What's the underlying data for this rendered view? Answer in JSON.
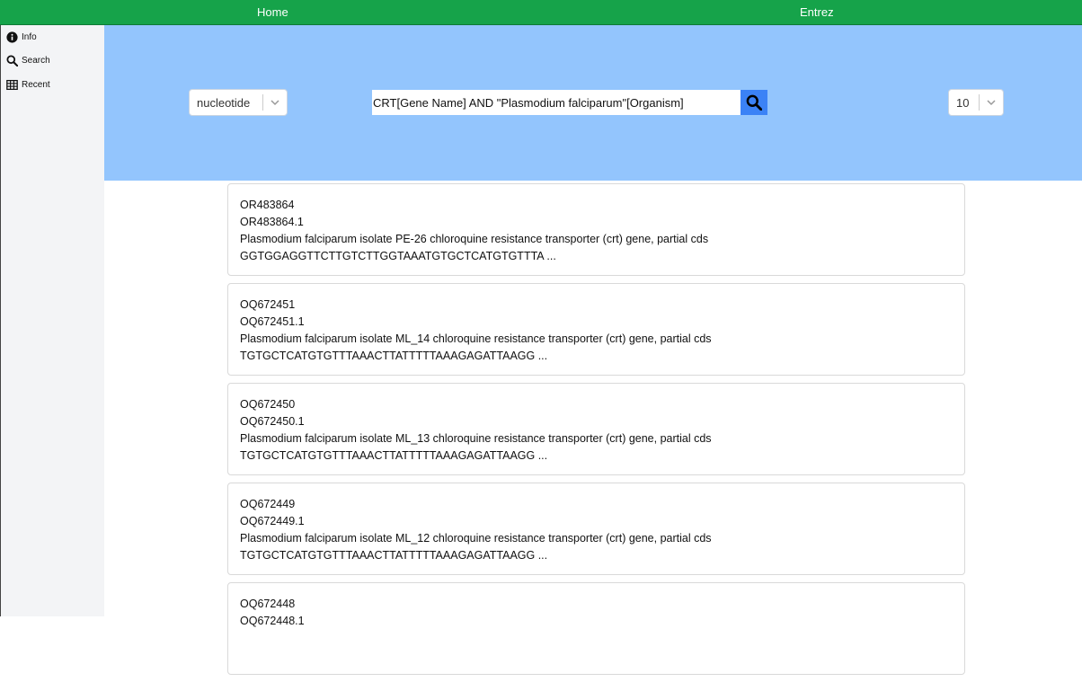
{
  "nav": {
    "home": "Home",
    "entrez": "Entrez"
  },
  "sidebar": {
    "items": [
      {
        "label": "Info",
        "icon": "info-icon"
      },
      {
        "label": "Search",
        "icon": "search-icon"
      },
      {
        "label": "Recent",
        "icon": "table-icon"
      }
    ]
  },
  "search": {
    "database": "nucleotide",
    "query": "CRT[Gene Name] AND \"Plasmodium falciparum\"[Organism]",
    "count": "10"
  },
  "colors": {
    "topbar": "#16a34a",
    "search_panel": "#93c5fd",
    "search_button": "#3b82f6",
    "sidebar": "#f3f4f6"
  },
  "results": [
    {
      "id": "OR483864",
      "accession": "OR483864.1",
      "title": "Plasmodium falciparum isolate PE-26 chloroquine resistance transporter (crt) gene, partial cds",
      "sequence": "GGTGGAGGTTCTTGTCTTGGTAAATGTGCTCATGTGTTTA ..."
    },
    {
      "id": "OQ672451",
      "accession": "OQ672451.1",
      "title": "Plasmodium falciparum isolate ML_14 chloroquine resistance transporter (crt) gene, partial cds",
      "sequence": "TGTGCTCATGTGTTTAAACTTATTTTTAAAGAGATTAAGG ..."
    },
    {
      "id": "OQ672450",
      "accession": "OQ672450.1",
      "title": "Plasmodium falciparum isolate ML_13 chloroquine resistance transporter (crt) gene, partial cds",
      "sequence": "TGTGCTCATGTGTTTAAACTTATTTTTAAAGAGATTAAGG ..."
    },
    {
      "id": "OQ672449",
      "accession": "OQ672449.1",
      "title": "Plasmodium falciparum isolate ML_12 chloroquine resistance transporter (crt) gene, partial cds",
      "sequence": "TGTGCTCATGTGTTTAAACTTATTTTTAAAGAGATTAAGG ..."
    },
    {
      "id": "OQ672448",
      "accession": "OQ672448.1",
      "title": "",
      "sequence": ""
    }
  ]
}
